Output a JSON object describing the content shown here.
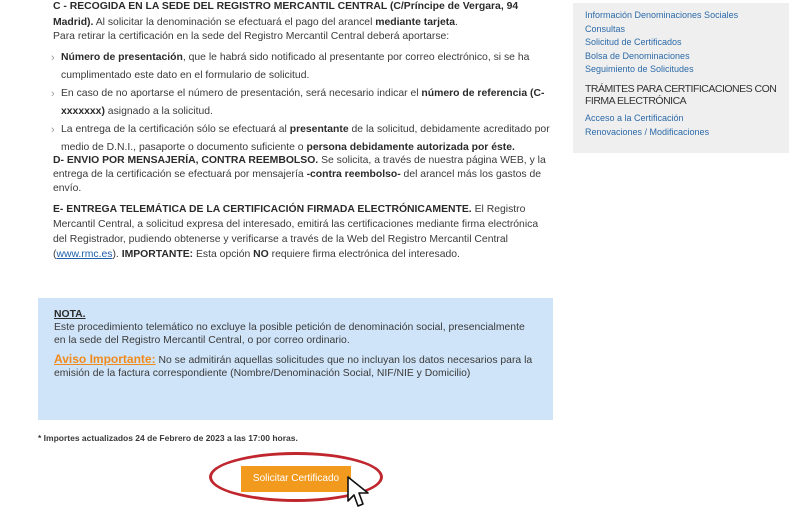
{
  "section_c": {
    "title": "C - RECOGIDA EN LA SEDE DEL REGISTRO MERCANTIL CENTRAL (C/Príncipe de Vergara, 94 Madrid).",
    "text1": " Al solicitar la denominación se efectuará el pago del arancel ",
    "text1_bold": "mediante tarjeta",
    "text1_end": ".",
    "text2": "Para retirar la certificación en la sede del Registro Mercantil Central deberá aportarse:"
  },
  "bullets": [
    {
      "bold_start": "Número de presentación",
      "text": ", que le habrá sido notificado al presentante por correo electrónico, si se ha cumplimentado este dato en el formulario de solicitud."
    },
    {
      "text": "En caso de no aportarse el número de presentación, será necesario indicar el ",
      "bold": "número de referencia (C-xxxxxxx)",
      "text_end": " asignado a la solicitud."
    },
    {
      "text": "La entrega de la certificación sólo se efectuará al ",
      "bold": "presentante",
      "text_mid": " de la solicitud, debidamente acreditado por medio de D.N.I., pasaporte o documento suficiente o ",
      "bold2": "persona debidamente autorizada por éste."
    }
  ],
  "section_d": {
    "title": "D- ENVIO POR MENSAJERÍA, CONTRA REEMBOLSO.",
    "text": " Se solicita, a través de nuestra página WEB, y la entrega de la certificación se efectuará por mensajería ",
    "bold": "-contra reembolso-",
    "text_end": " del arancel más los gastos de envío."
  },
  "section_e": {
    "title": "E- ENTREGA TELEMÁTICA DE LA CERTIFICACIÓN FIRMADA ELECTRÓNICAMENTE.",
    "text": " El Registro Mercantil Central, a solicitud expresa del interesado, emitirá las certificaciones mediante firma electrónica del Registrador, pudiendo obtenerse y verificarse a través de la Web del Registro Mercantil Central (",
    "link": "www.rmc.es",
    "text2": "). ",
    "important": "IMPORTANTE:",
    "text3": "  Esta opción ",
    "no": "NO",
    "text4": " requiere firma electrónica del interesado."
  },
  "nota": {
    "title": "NOTA.",
    "text": "Este procedimiento telemático no excluye la posible petición de denominación social, presencialmente en la sede del Registro Mercantil Central, o por correo ordinario.",
    "aviso_title": "Aviso Importante:",
    "aviso_text": " No se admitirán aquellas solicitudes que no incluyan los datos necesarios para la emisión de la factura correspondiente (Nombre/Denominación Social, NIF/NIE y Domicilio)"
  },
  "footnote": "* Importes actualizados 24 de Febrero de 2023 a las 17:00 horas.",
  "button_label": "Solicitar Certificado",
  "sidebar": {
    "links_top": [
      "Información Denominaciones Sociales",
      "Consultas",
      "Solicitud de Certificados",
      "Bolsa de Denominaciones",
      "Seguimiento de Solicitudes"
    ],
    "heading_line1": "TRÁMITES PARA CERTIFICACIONES CON",
    "heading_line2": "FIRMA ELECTRÓNICA",
    "links_bottom": [
      "Acceso a la Certificación",
      "Renovaciones / Modificaciones"
    ]
  },
  "colors": {
    "accent_orange": "#f29a1e",
    "nota_bg": "#cfe4f8",
    "highlight_ring": "#c0262d",
    "link_blue": "#2c6aa8"
  }
}
